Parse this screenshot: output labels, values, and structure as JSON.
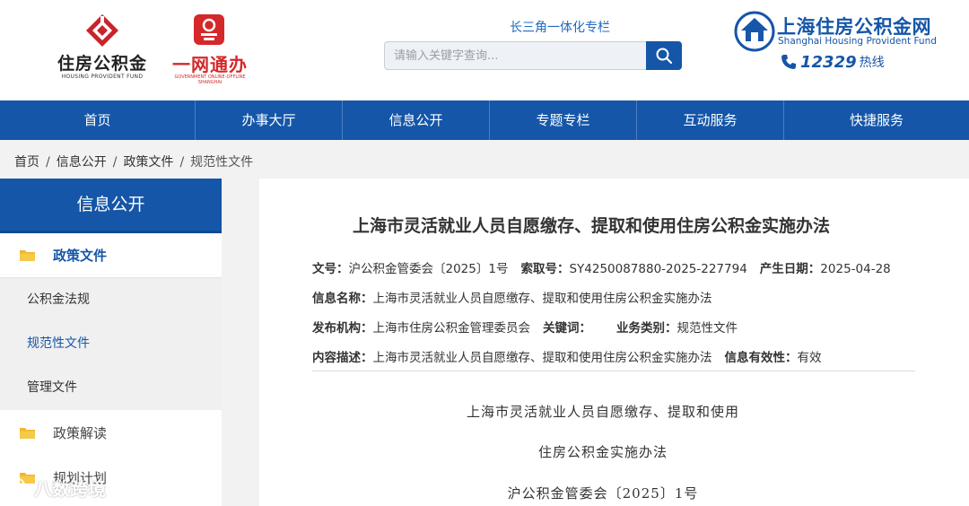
{
  "header": {
    "logo_hpf": {
      "title": "住房公积金",
      "subtitle": "HOUSING PROVIDENT FUND"
    },
    "logo_onenet": {
      "title": "一网通办",
      "subtitle": "GOVERNMENT ONLINE-OFFLINE SHANGHAI"
    },
    "special_link": "长三角一体化专栏",
    "search": {
      "placeholder": "请输入关键字查询..."
    },
    "brand": {
      "name": "上海住房公积金网",
      "name_en": "Shanghai Housing Provident Fund",
      "hotline_number": "12329",
      "hotline_label": "热线"
    }
  },
  "nav": {
    "items": [
      "首页",
      "办事大厅",
      "信息公开",
      "专题专栏",
      "互动服务",
      "快捷服务"
    ]
  },
  "breadcrumb": {
    "items": [
      "首页",
      "信息公开",
      "政策文件",
      "规范性文件"
    ]
  },
  "sidebar": {
    "title": "信息公开",
    "active_category": "政策文件",
    "sub_items": [
      "公积金法规",
      "规范性文件",
      "管理文件"
    ],
    "selected_sub": "规范性文件",
    "other_categories": [
      "政策解读",
      "规划计划"
    ]
  },
  "article": {
    "title": "上海市灵活就业人员自愿缴存、提取和使用住房公积金实施办法",
    "meta": {
      "doc_no_label": "文号：",
      "doc_no": "沪公积金管委会〔2025〕1号",
      "index_label": "索取号：",
      "index": "SY4250087880-2025-227794",
      "date_label": "产生日期：",
      "date": "2025-04-28",
      "name_label": "信息名称：",
      "name": "上海市灵活就业人员自愿缴存、提取和使用住房公积金实施办法",
      "org_label": "发布机构：",
      "org": "上海市住房公积金管理委员会",
      "keyword_label": "关键词：",
      "category_label": "业务类别：",
      "category": "规范性文件",
      "desc_label": "内容描述：",
      "desc": "上海市灵活就业人员自愿缴存、提取和使用住房公积金实施办法",
      "validity_label": "信息有效性：",
      "validity": "有效"
    },
    "body": [
      "上海市灵活就业人员自愿缴存、提取和使用",
      "住房公积金实施办法",
      "沪公积金管委会〔2025〕1号"
    ]
  },
  "watermark": "八数跨境",
  "colors": {
    "primary": "#1556a8",
    "red": "#d4282a",
    "background": "#f2f2f2"
  }
}
